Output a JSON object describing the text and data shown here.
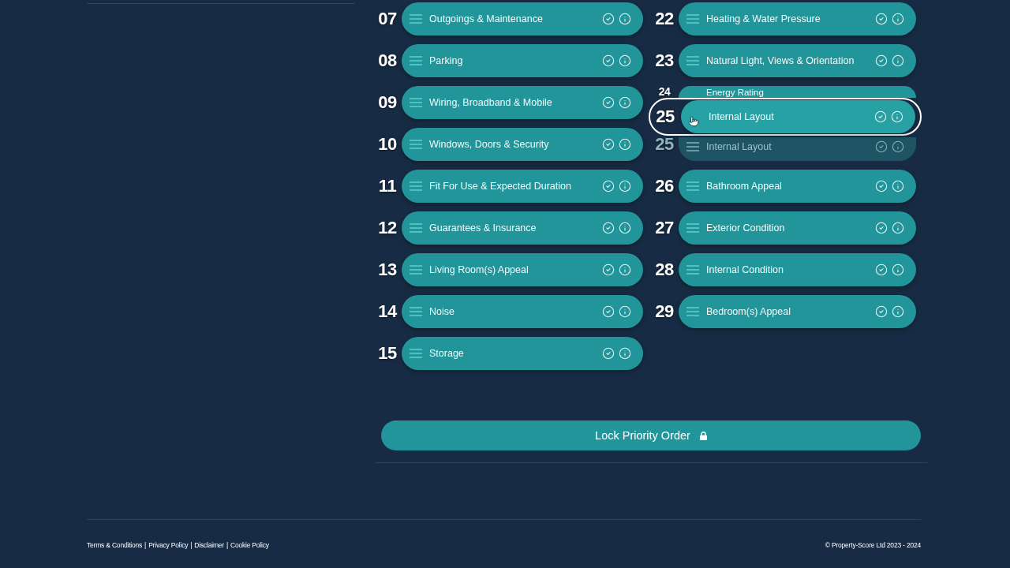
{
  "priority_columns": [
    {
      "items": [
        {
          "number": "07",
          "label": "Outgoings & Maintenance",
          "covered": false,
          "ghost": false
        },
        {
          "number": "08",
          "label": "Parking",
          "covered": false,
          "ghost": false
        },
        {
          "number": "09",
          "label": "Wiring, Broadband & Mobile",
          "covered": false,
          "ghost": false
        },
        {
          "number": "10",
          "label": "Windows, Doors & Security",
          "covered": false,
          "ghost": false
        },
        {
          "number": "11",
          "label": "Fit For Use & Expected Duration",
          "covered": false,
          "ghost": false
        },
        {
          "number": "12",
          "label": "Guarantees & Insurance",
          "covered": false,
          "ghost": false
        },
        {
          "number": "13",
          "label": "Living Room(s) Appeal",
          "covered": false,
          "ghost": false
        },
        {
          "number": "14",
          "label": "Noise",
          "covered": false,
          "ghost": false
        },
        {
          "number": "15",
          "label": "Storage",
          "covered": false,
          "ghost": false
        }
      ]
    },
    {
      "items": [
        {
          "number": "22",
          "label": "Heating & Water Pressure",
          "covered": false,
          "ghost": false
        },
        {
          "number": "23",
          "label": "Natural Light, Views & Orientation",
          "covered": false,
          "ghost": false
        },
        {
          "number": "24",
          "label": "Energy Rating",
          "covered": true,
          "ghost": false
        },
        {
          "number": "25",
          "label": "Internal Layout",
          "covered": false,
          "ghost": true
        },
        {
          "number": "26",
          "label": "Bathroom Appeal",
          "covered": false,
          "ghost": false
        },
        {
          "number": "27",
          "label": "Exterior Condition",
          "covered": false,
          "ghost": false
        },
        {
          "number": "28",
          "label": "Internal Condition",
          "covered": false,
          "ghost": false
        },
        {
          "number": "29",
          "label": "Bedroom(s) Appeal",
          "covered": false,
          "ghost": false
        }
      ]
    }
  ],
  "dragged_item": {
    "number": "25",
    "label": "Internal Layout"
  },
  "lock_button": {
    "label": "Lock Priority Order"
  },
  "footer": {
    "links": [
      "Terms & Conditions",
      "Privacy Policy",
      "Disclaimer",
      "Cookie Policy"
    ],
    "separators": [
      "|",
      "|",
      "|"
    ],
    "copyright": "© Property-Score Ltd 2023 - 2024"
  }
}
